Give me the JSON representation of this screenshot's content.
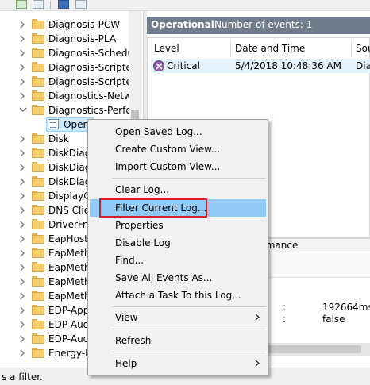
{
  "tree": {
    "items": [
      {
        "label": "Diagnosis-PCW"
      },
      {
        "label": "Diagnosis-PLA"
      },
      {
        "label": "Diagnosis-Schedul"
      },
      {
        "label": "Diagnosis-Scripted"
      },
      {
        "label": "Diagnosis-Scripted"
      },
      {
        "label": "Diagnostics-Netwo"
      },
      {
        "label": "Diagnostics-Perfor"
      },
      {
        "label": "Opera"
      },
      {
        "label": "Disk"
      },
      {
        "label": "DiskDiag"
      },
      {
        "label": "DiskDiag"
      },
      {
        "label": "DiskDiag"
      },
      {
        "label": "DisplayC"
      },
      {
        "label": "DNS Clie"
      },
      {
        "label": "DriverFra"
      },
      {
        "label": "EapHost"
      },
      {
        "label": "EapMeth"
      },
      {
        "label": "EapMeth"
      },
      {
        "label": "EapMeth"
      },
      {
        "label": "EapMeth"
      },
      {
        "label": "EDP-App"
      },
      {
        "label": "EDP-Aud"
      },
      {
        "label": "EDP-Aud"
      },
      {
        "label": "Energy-E"
      }
    ]
  },
  "panel": {
    "title": "Operational",
    "count": "Number of events: 1",
    "columns": [
      "Level",
      "Date and Time",
      "Sou"
    ],
    "row": {
      "level": "Critical",
      "datetime": "5/4/2018 10:48:36 AM",
      "source": "Dia"
    },
    "lower_header": "rmance",
    "details": [
      {
        "sep": ":",
        "value": "192664ms"
      },
      {
        "sep": ":",
        "value": "false"
      }
    ]
  },
  "status": {
    "text": "s a filter."
  },
  "context_menu": {
    "items": [
      {
        "label": "Open Saved Log..."
      },
      {
        "label": "Create Custom View..."
      },
      {
        "label": "Import Custom View..."
      },
      {
        "label": "Clear Log..."
      },
      {
        "label": "Filter Current Log..."
      },
      {
        "label": "Properties"
      },
      {
        "label": "Disable Log"
      },
      {
        "label": "Find..."
      },
      {
        "label": "Save All Events As..."
      },
      {
        "label": "Attach a Task To this Log..."
      },
      {
        "label": "View"
      },
      {
        "label": "Refresh"
      },
      {
        "label": "Help"
      }
    ]
  },
  "colors": {
    "accent_highlight": "#91c9f7",
    "callout_border": "#d0202a",
    "header_bg": "#6f7d8c"
  }
}
